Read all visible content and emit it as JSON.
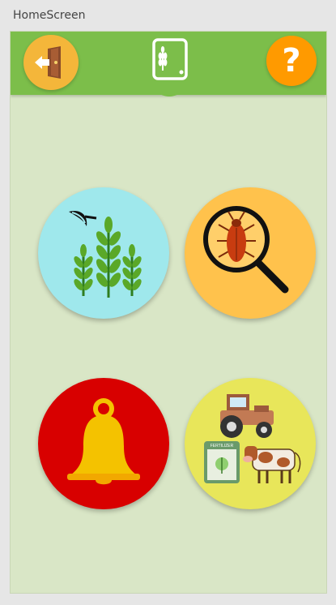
{
  "window": {
    "title": "HomeScreen"
  },
  "header": {
    "exit_icon": "door-exit-icon",
    "logo_icon": "tablet-wheat-icon",
    "help_label": "?",
    "colors": {
      "bar": "#7cbe4a",
      "exit": "#f4b63a",
      "help": "#ff9a00"
    }
  },
  "tiles": [
    {
      "icon": "crop-sickle-icon",
      "color": "#9fe8ec"
    },
    {
      "icon": "pest-magnifier-icon",
      "color": "#ffc24c"
    },
    {
      "icon": "alert-bell-icon",
      "color": "#d80000"
    },
    {
      "icon": "farm-supplies-icon",
      "color": "#e8e65a"
    }
  ],
  "labels": {
    "fertilizer": "FERTILIZER"
  }
}
